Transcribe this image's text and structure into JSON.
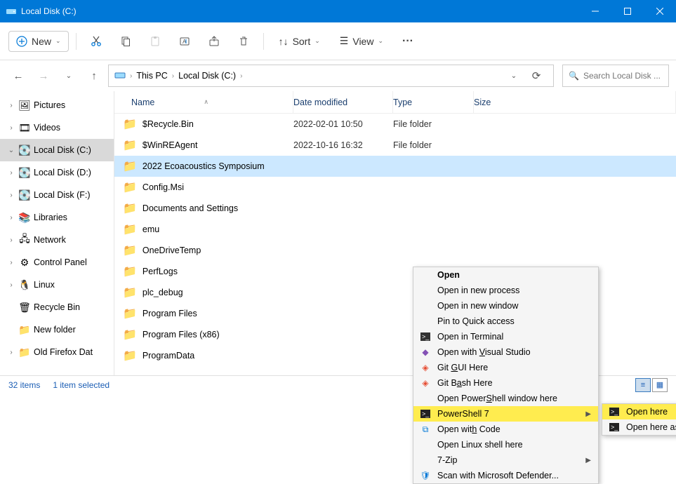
{
  "window": {
    "title": "Local Disk (C:)"
  },
  "toolbar": {
    "new": "New",
    "sort": "Sort",
    "view": "View"
  },
  "breadcrumbs": {
    "pc": "This PC",
    "drive": "Local Disk (C:)"
  },
  "search": {
    "placeholder": "Search Local Disk ..."
  },
  "tree": [
    {
      "label": "Pictures",
      "icon": "🖼",
      "exp": "›"
    },
    {
      "label": "Videos",
      "icon": "🎞",
      "exp": "›"
    },
    {
      "label": "Local Disk (C:)",
      "icon": "💽",
      "exp": "⌄",
      "sel": true
    },
    {
      "label": "Local Disk (D:)",
      "icon": "💽",
      "exp": "›"
    },
    {
      "label": "Local Disk (F:)",
      "icon": "💽",
      "exp": "›"
    },
    {
      "label": "Libraries",
      "icon": "📚",
      "exp": "›"
    },
    {
      "label": "Network",
      "icon": "🖧",
      "exp": "›"
    },
    {
      "label": "Control Panel",
      "icon": "⚙",
      "exp": "›"
    },
    {
      "label": "Linux",
      "icon": "🐧",
      "exp": "›"
    },
    {
      "label": "Recycle Bin",
      "icon": "🗑",
      "exp": ""
    },
    {
      "label": "New folder",
      "icon": "📁",
      "exp": ""
    },
    {
      "label": "Old Firefox Dat",
      "icon": "📁",
      "exp": "›"
    }
  ],
  "columns": {
    "name": "Name",
    "date": "Date modified",
    "type": "Type",
    "size": "Size"
  },
  "rows": [
    {
      "name": "$Recycle.Bin",
      "date": "2022-02-01 10:50",
      "type": "File folder"
    },
    {
      "name": "$WinREAgent",
      "date": "2022-10-16 16:32",
      "type": "File folder"
    },
    {
      "name": "2022 Ecoacoustics Symposium",
      "sel": true
    },
    {
      "name": "Config.Msi"
    },
    {
      "name": "Documents and Settings"
    },
    {
      "name": "emu"
    },
    {
      "name": "OneDriveTemp"
    },
    {
      "name": "PerfLogs"
    },
    {
      "name": "plc_debug"
    },
    {
      "name": "Program Files"
    },
    {
      "name": "Program Files (x86)"
    },
    {
      "name": "ProgramData"
    }
  ],
  "context": {
    "open": "Open",
    "new_process": "Open in new process",
    "new_window": "Open in new window",
    "pin": "Pin to Quick access",
    "terminal": "Open in Terminal",
    "vs_pre": "Open with ",
    "vs_u": "V",
    "vs_post": "isual Studio",
    "gitgui_pre": "Git ",
    "gitgui_u": "G",
    "gitgui_post": "UI Here",
    "gitbash_pre": "Git B",
    "gitbash_u": "a",
    "gitbash_post": "sh Here",
    "ps_win_pre": "Open Power",
    "ps_win_u": "S",
    "ps_win_post": "hell window here",
    "ps7": "PowerShell 7",
    "code_pre": "Open wit",
    "code_u": "h",
    "code_post": " Code",
    "linux": "Open Linux shell here",
    "sevenzip": "7-Zip",
    "defender": "Scan with Microsoft Defender..."
  },
  "submenu": {
    "open_here": "Open here",
    "open_admin": "Open here as Administrator"
  },
  "status": {
    "items": "32 items",
    "selected": "1 item selected"
  }
}
